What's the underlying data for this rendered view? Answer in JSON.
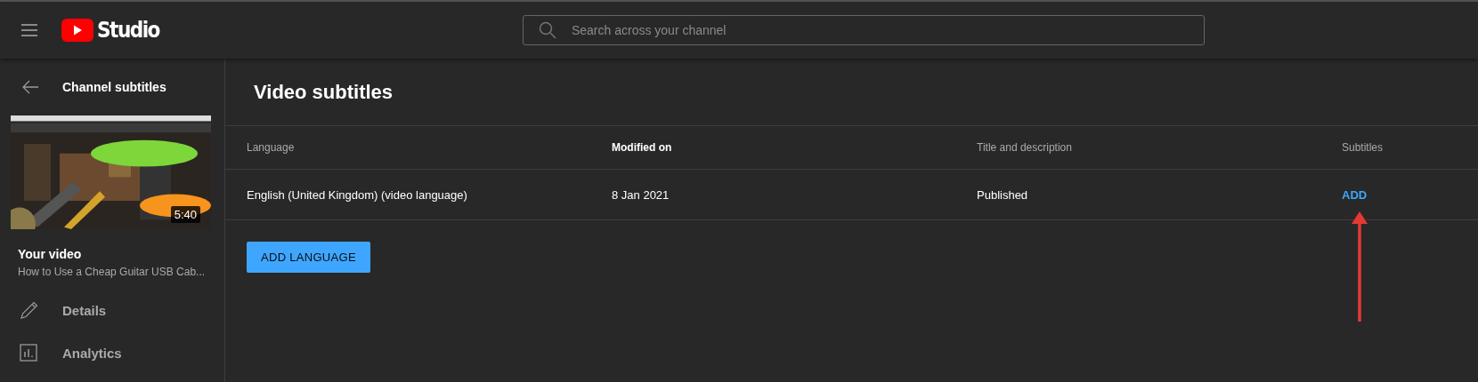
{
  "header": {
    "logo_text": "Studio",
    "search": {
      "placeholder": "Search across your channel"
    }
  },
  "sidebar": {
    "back_label": "Channel subtitles",
    "video": {
      "thumbnail": {
        "kind": "picture",
        "duration": "5:40"
      },
      "heading": "Your video",
      "title": "How to Use a Cheap Guitar USB Cab..."
    },
    "items": [
      {
        "label": "Details",
        "selected": false
      },
      {
        "label": "Analytics",
        "selected": false
      }
    ]
  },
  "main": {
    "title": "Video subtitles",
    "table": {
      "columns": [
        {
          "label": "Language",
          "sorted": false
        },
        {
          "label": "Modified on",
          "sorted": true
        },
        {
          "label": "Title and description",
          "sorted": false
        },
        {
          "label": "Subtitles",
          "sorted": false
        }
      ],
      "rows": [
        {
          "language": "English (United Kingdom) (video language)",
          "modified": "8 Jan 2021",
          "title_description": "Published",
          "subtitles_action": "ADD"
        }
      ]
    },
    "add_button": "ADD LANGUAGE",
    "annotation": {
      "kind": "arrow",
      "color": "#e53935"
    }
  }
}
